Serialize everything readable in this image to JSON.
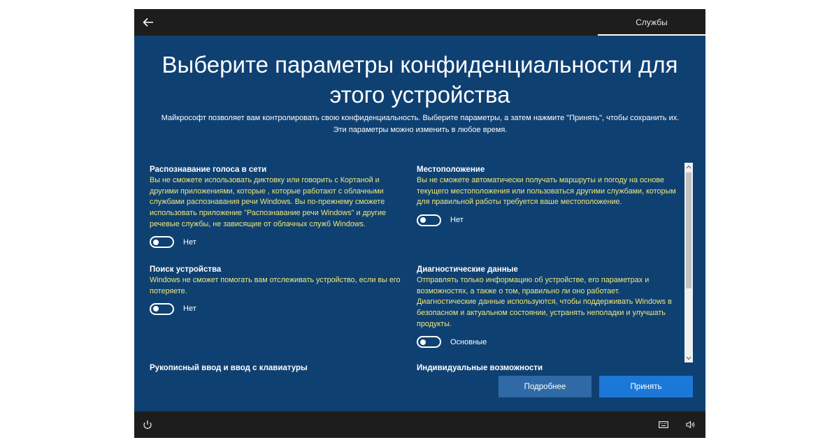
{
  "topbar": {
    "tab_label": "Службы"
  },
  "header": {
    "title": "Выберите параметры конфиденциальности для этого устройства",
    "subtitle": "Майкрософт позволяет вам контролировать свою конфиденциальность. Выберите параметры, а затем нажмите \"Принять\", чтобы сохранить их. Эти параметры можно изменить в любое время."
  },
  "settings": {
    "left": [
      {
        "title": "Распознавание голоса в сети",
        "description": "Вы не сможете использовать диктовку или говорить с Кортаной и другими приложениями, которые , которые работают с облачными службами распознавания речи Windows. Вы по-прежнему сможете использовать приложение \"Распознавание речи Windows\" и другие речевые службы, не зависящие от облачных служб Windows.",
        "toggle_state": "Нет"
      },
      {
        "title": "Поиск устройства",
        "description": "Windows не сможет помогать вам отслеживать устройство, если вы его потеряете.",
        "toggle_state": "Нет"
      },
      {
        "title": "Рукописный ввод и ввод с клавиатуры"
      }
    ],
    "right": [
      {
        "title": "Местоположение",
        "description": "Вы не сможете автоматически получать маршруты и погоду на основе текущего местоположения или пользоваться другими службами, которым для правильной работы требуется ваше местоположение.",
        "toggle_state": "Нет"
      },
      {
        "title": "Диагностические данные",
        "description": "Отправлять только информацию об устройстве, его параметрах и возможностях, а также о том, правильно ли оно работает. Диагностические данные используются, чтобы поддерживать Windows в безопасном и актуальном состоянии, устранять неполадки и улучшать продукты.",
        "toggle_state": "Основные"
      },
      {
        "title": "Индивидуальные возможности"
      }
    ]
  },
  "buttons": {
    "more": "Подробнее",
    "accept": "Принять"
  },
  "colors": {
    "background": "#0f4072",
    "bars": "#1d1d1d",
    "description_text": "#f0e87a",
    "accept_button": "#1b78d8",
    "more_button": "#2f6aa6"
  },
  "icons": {
    "back": "arrow-left-icon",
    "accessibility": "ease-of-access-icon",
    "keyboard": "keyboard-icon",
    "volume": "volume-icon"
  }
}
